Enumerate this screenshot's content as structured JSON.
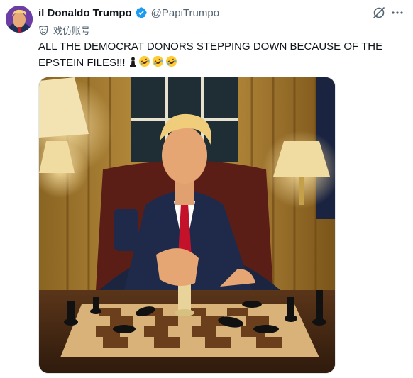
{
  "post": {
    "author": {
      "display_name": "il Donaldo Trumpo",
      "handle": "@PapiTrumpo",
      "verified": true,
      "verified_color": "#1d9bf0"
    },
    "account_label": {
      "icon": "parody-mask-icon",
      "text": "戏仿账号"
    },
    "text": "ALL THE DEMOCRAT DONORS STEPPING DOWN BECAUSE OF THE EPSTEIN FILES!!!",
    "emojis": [
      "chess-pawn-icon",
      "rolling-laughing-icon",
      "rolling-laughing-icon",
      "rolling-laughing-icon"
    ],
    "actions": {
      "grok_icon": "grok-icon",
      "more_icon": "more-icon"
    }
  },
  "colors": {
    "text_primary": "#0f1419",
    "text_secondary": "#536471",
    "accent_blue": "#1d9bf0"
  }
}
